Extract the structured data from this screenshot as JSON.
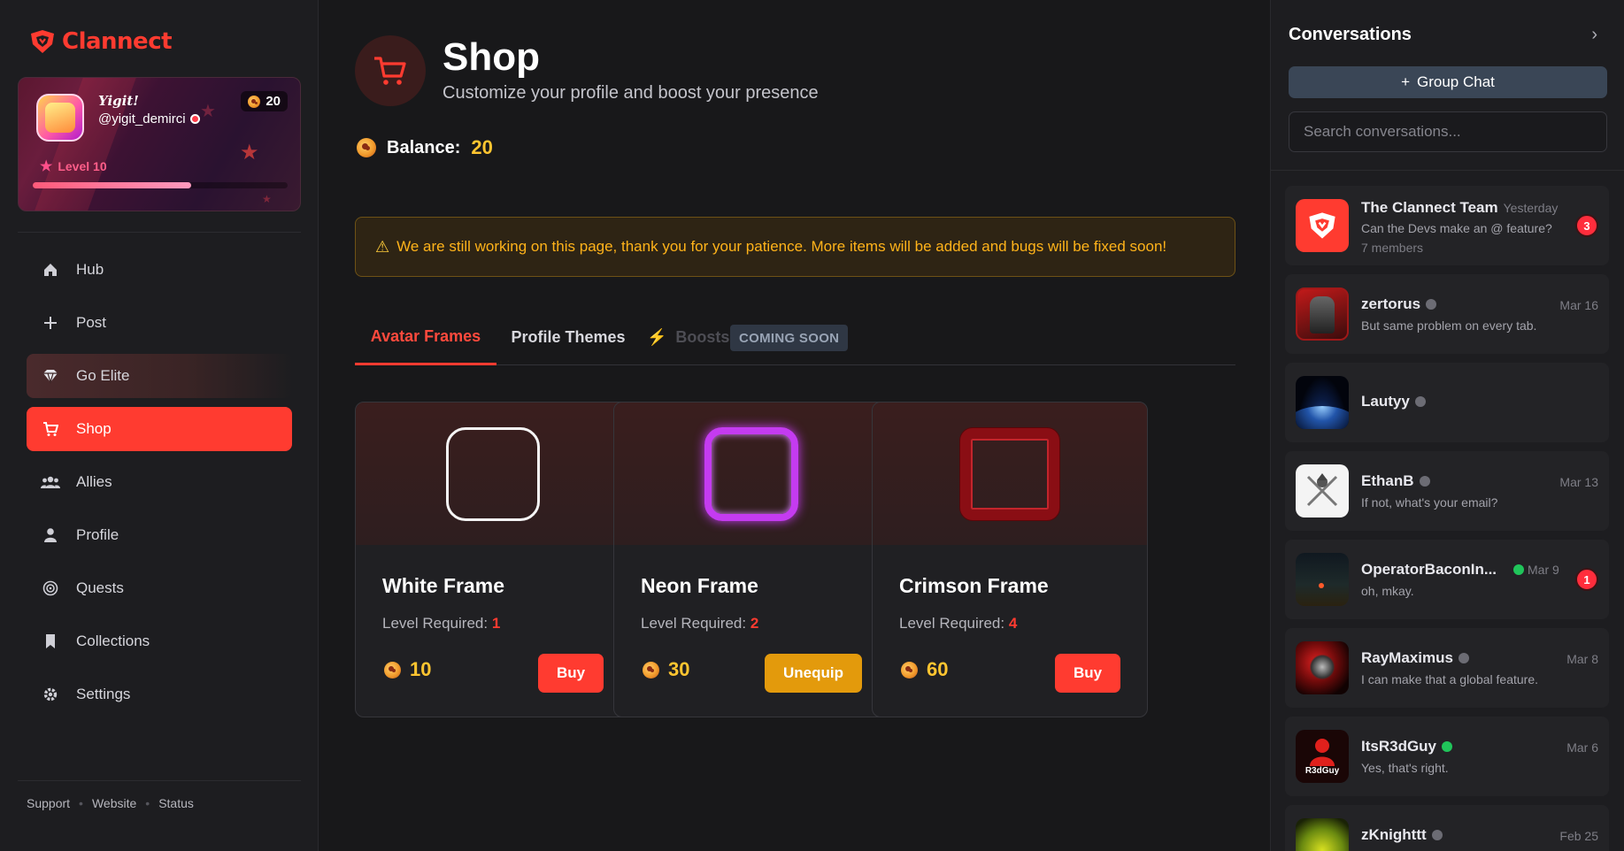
{
  "brand": {
    "name": "Clannect",
    "accent": "#ff3b30"
  },
  "profile": {
    "display_name": "Yigit!",
    "handle": "@yigit_demirci",
    "coins": "20",
    "level": "Level 10",
    "level_progress": 0.62
  },
  "nav": {
    "items": [
      {
        "label": "Hub",
        "icon": "home-icon"
      },
      {
        "label": "Post",
        "icon": "plus-icon"
      },
      {
        "label": "Go Elite",
        "icon": "gem-icon"
      },
      {
        "label": "Shop",
        "icon": "cart-icon"
      },
      {
        "label": "Allies",
        "icon": "users-icon"
      },
      {
        "label": "Profile",
        "icon": "person-icon"
      },
      {
        "label": "Quests",
        "icon": "target-icon"
      },
      {
        "label": "Collections",
        "icon": "bookmark-icon"
      },
      {
        "label": "Settings",
        "icon": "gear-icon"
      }
    ],
    "active": "Shop"
  },
  "footer": {
    "support": "Support",
    "website": "Website",
    "status": "Status"
  },
  "page": {
    "title": "Shop",
    "subtitle": "Customize your profile and boost your presence",
    "balance_label": "Balance:",
    "balance_value": "20"
  },
  "notice": "We are still working on this page, thank you for your patience. More items will be added and bugs will be fixed soon!",
  "tabs": {
    "avatar_frames": "Avatar Frames",
    "profile_themes": "Profile Themes",
    "boosts": "Boosts",
    "coming_soon": "COMING SOON",
    "active": "Avatar Frames"
  },
  "items": [
    {
      "title": "White Frame",
      "req_label": "Level Required:",
      "req_level": "1",
      "price": "10",
      "button": "Buy",
      "style": "white"
    },
    {
      "title": "Neon Frame",
      "req_label": "Level Required:",
      "req_level": "2",
      "price": "30",
      "button": "Unequip",
      "style": "neon"
    },
    {
      "title": "Crimson Frame",
      "req_label": "Level Required:",
      "req_level": "4",
      "price": "60",
      "button": "Buy",
      "style": "crimson"
    }
  ],
  "conversations_panel": {
    "title": "Conversations",
    "group_chat": "Group Chat",
    "search_placeholder": "Search conversations..."
  },
  "conversations": [
    {
      "name": "The Clannect Team",
      "time": "Yesterday",
      "message": "Can the Devs make an @ feature?",
      "members": "7 members",
      "unread": "3"
    },
    {
      "name": "zertorus",
      "time": "Mar 16",
      "message": "But same problem on every tab.",
      "status": "offline"
    },
    {
      "name": "Lautyy",
      "time": "",
      "message": "",
      "status": "offline"
    },
    {
      "name": "EthanB",
      "time": "Mar 13",
      "message": "If not, what's your email?",
      "status": "offline"
    },
    {
      "name": "OperatorBaconIn...",
      "time": "Mar 9",
      "message": "oh, mkay.",
      "status": "online",
      "unread": "1"
    },
    {
      "name": "RayMaximus",
      "time": "Mar 8",
      "message": "I can make that a global feature.",
      "status": "offline"
    },
    {
      "name": "ItsR3dGuy",
      "time": "Mar 6",
      "message": "Yes, that's right.",
      "status": "online",
      "avatar_text": "R3dGuy"
    },
    {
      "name": "zKnighttt",
      "time": "Feb 25",
      "message": "",
      "status": "offline"
    }
  ]
}
